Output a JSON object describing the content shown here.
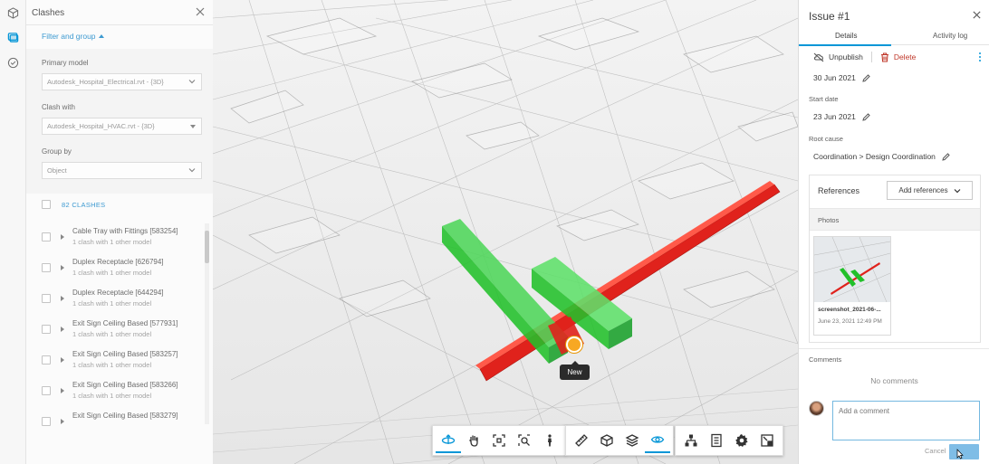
{
  "left_rail": {
    "items": [
      {
        "name": "models",
        "icon": "cube-icon"
      },
      {
        "name": "clashes",
        "icon": "clash-icon",
        "active": true
      },
      {
        "name": "issues",
        "icon": "check-circle-icon"
      }
    ]
  },
  "clash_panel": {
    "title": "Clashes",
    "filter_link": "Filter and group",
    "primary_model_label": "Primary model",
    "primary_model_value": "Autodesk_Hospital_Electrical.rvt - {3D}",
    "clash_with_label": "Clash with",
    "clash_with_value": "Autodesk_Hospital_HVAC.rvt - {3D}",
    "group_by_label": "Group by",
    "group_by_value": "Object",
    "count_text": "82 CLASHES",
    "items": [
      {
        "name": "Cable Tray with Fittings [583254]",
        "sub": "1 clash with 1 other model"
      },
      {
        "name": "Duplex Receptacle [626794]",
        "sub": "1 clash with 1 other model"
      },
      {
        "name": "Duplex Receptacle [644294]",
        "sub": "1 clash with 1 other model"
      },
      {
        "name": "Exit Sign Ceiling Based [577931]",
        "sub": "1 clash with 1 other model"
      },
      {
        "name": "Exit Sign Ceiling Based [583257]",
        "sub": "1 clash with 1 other model"
      },
      {
        "name": "Exit Sign Ceiling Based [583266]",
        "sub": "1 clash with 1 other model"
      },
      {
        "name": "Exit Sign Ceiling Based [583279]",
        "sub": ""
      }
    ]
  },
  "viewport": {
    "marker_label": "New",
    "marker_color": "#f7a823",
    "clash_colors": {
      "hvac": "#22c02a",
      "electrical": "#e0221c"
    },
    "toolbar": [
      {
        "name": "orbit",
        "icon": "orbit-icon",
        "active": true
      },
      {
        "name": "pan",
        "icon": "hand-icon"
      },
      {
        "name": "fit",
        "icon": "fit-view-icon"
      },
      {
        "name": "zoom",
        "icon": "zoom-window-icon"
      },
      {
        "name": "first-person",
        "icon": "person-icon"
      },
      {
        "name": "measure",
        "icon": "ruler-icon"
      },
      {
        "name": "section",
        "icon": "section-box-icon"
      },
      {
        "name": "layers",
        "icon": "layers-icon"
      },
      {
        "name": "ghosting",
        "icon": "eye-icon",
        "active": true
      },
      {
        "name": "model-browser",
        "icon": "hierarchy-icon"
      },
      {
        "name": "properties",
        "icon": "properties-icon"
      },
      {
        "name": "settings",
        "icon": "gear-icon"
      },
      {
        "name": "fullscreen",
        "icon": "fullscreen-icon"
      }
    ]
  },
  "issue_panel": {
    "title": "Issue #1",
    "tabs": [
      "Details",
      "Activity log"
    ],
    "unpublish": "Unpublish",
    "delete": "Delete",
    "due_date": "30 Jun 2021",
    "start_date_label": "Start date",
    "start_date": "23 Jun 2021",
    "root_cause_label": "Root cause",
    "root_cause": "Coordination > Design Coordination",
    "references_title": "References",
    "add_references": "Add references",
    "photos_label": "Photos",
    "photo_name": "screenshot_2021-06-...",
    "photo_date": "June 23, 2021 12:49 PM",
    "comments_label": "Comments",
    "no_comments": "No comments",
    "comment_placeholder": "Add a comment",
    "cancel": "Cancel",
    "accent": "#0696d7",
    "danger": "#c0392b"
  }
}
